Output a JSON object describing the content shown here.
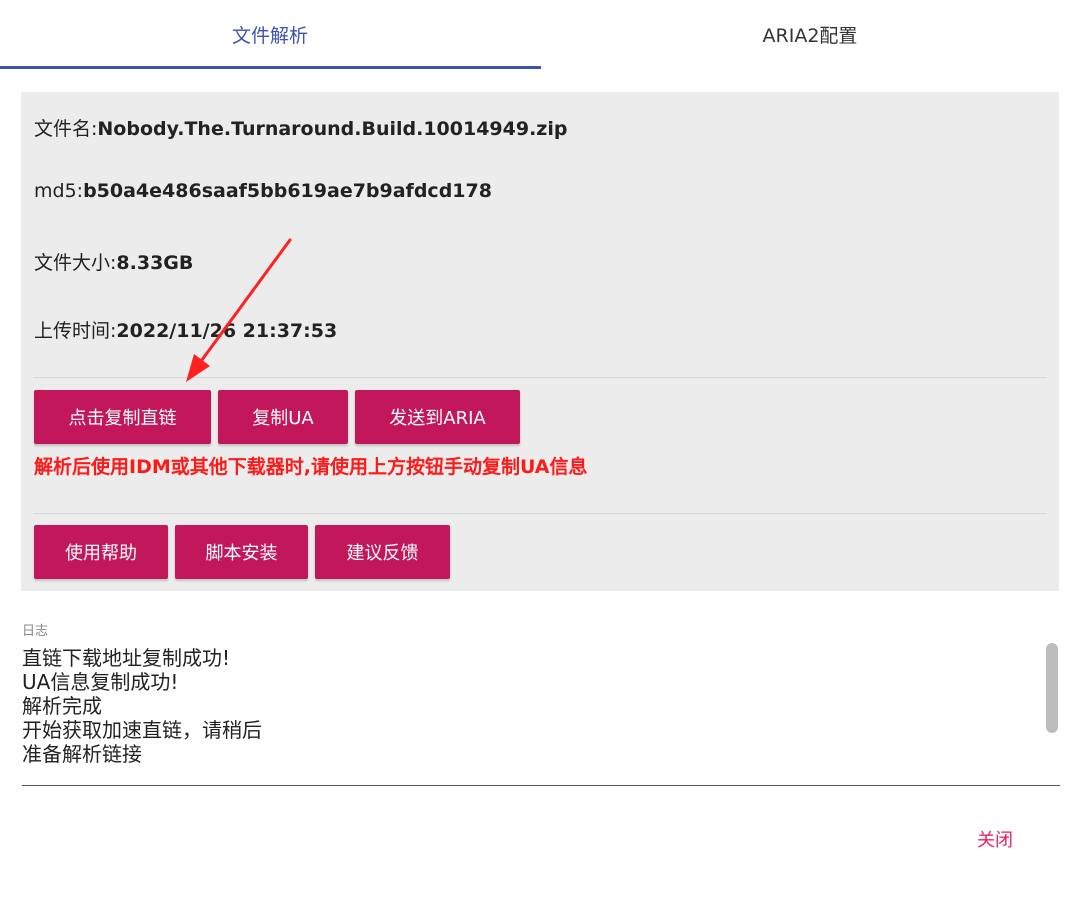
{
  "tabs": {
    "parse": "文件解析",
    "aria": "ARIA2配置"
  },
  "file": {
    "name_label": "文件名:",
    "name_value": "Nobody.The.Turnaround.Build.10014949.zip",
    "md5_label": "md5:",
    "md5_value": "b50a4e486saaf5bb619ae7b9afdcd178",
    "size_label": "文件大小:",
    "size_value": "8.33GB",
    "time_label": "上传时间:",
    "time_value": "2022/11/26 21:37:53"
  },
  "actions": {
    "copy_link": "点击复制直链",
    "copy_ua": "复制UA",
    "send_aria": "发送到ARIA"
  },
  "warning": "解析后使用IDM或其他下载器时,请使用上方按钮手动复制UA信息",
  "help_actions": {
    "help": "使用帮助",
    "script": "脚本安装",
    "feedback": "建议反馈"
  },
  "log": {
    "label": "日志",
    "text": "直链下载地址复制成功!\nUA信息复制成功!\n解析完成\n开始获取加速直链，请稍后\n准备解析链接"
  },
  "footer": {
    "close": "关闭"
  },
  "colors": {
    "accent": "#3f51b5",
    "button": "#c2185b",
    "warning": "#ff1a1a",
    "close": "#e91e63",
    "panel": "#ececec",
    "arrow": "#ff2020"
  }
}
